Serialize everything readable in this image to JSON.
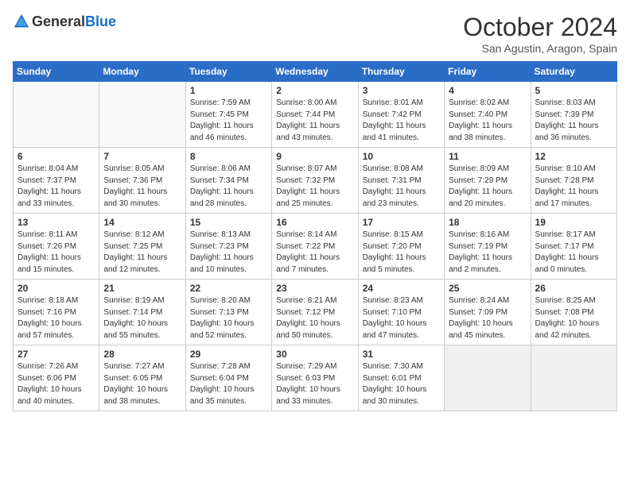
{
  "header": {
    "logo_general": "General",
    "logo_blue": "Blue",
    "month": "October 2024",
    "location": "San Agustin, Aragon, Spain"
  },
  "weekdays": [
    "Sunday",
    "Monday",
    "Tuesday",
    "Wednesday",
    "Thursday",
    "Friday",
    "Saturday"
  ],
  "weeks": [
    [
      {
        "day": "",
        "info": ""
      },
      {
        "day": "",
        "info": ""
      },
      {
        "day": "1",
        "info": "Sunrise: 7:59 AM\nSunset: 7:45 PM\nDaylight: 11 hours and 46 minutes."
      },
      {
        "day": "2",
        "info": "Sunrise: 8:00 AM\nSunset: 7:44 PM\nDaylight: 11 hours and 43 minutes."
      },
      {
        "day": "3",
        "info": "Sunrise: 8:01 AM\nSunset: 7:42 PM\nDaylight: 11 hours and 41 minutes."
      },
      {
        "day": "4",
        "info": "Sunrise: 8:02 AM\nSunset: 7:40 PM\nDaylight: 11 hours and 38 minutes."
      },
      {
        "day": "5",
        "info": "Sunrise: 8:03 AM\nSunset: 7:39 PM\nDaylight: 11 hours and 36 minutes."
      }
    ],
    [
      {
        "day": "6",
        "info": "Sunrise: 8:04 AM\nSunset: 7:37 PM\nDaylight: 11 hours and 33 minutes."
      },
      {
        "day": "7",
        "info": "Sunrise: 8:05 AM\nSunset: 7:36 PM\nDaylight: 11 hours and 30 minutes."
      },
      {
        "day": "8",
        "info": "Sunrise: 8:06 AM\nSunset: 7:34 PM\nDaylight: 11 hours and 28 minutes."
      },
      {
        "day": "9",
        "info": "Sunrise: 8:07 AM\nSunset: 7:32 PM\nDaylight: 11 hours and 25 minutes."
      },
      {
        "day": "10",
        "info": "Sunrise: 8:08 AM\nSunset: 7:31 PM\nDaylight: 11 hours and 23 minutes."
      },
      {
        "day": "11",
        "info": "Sunrise: 8:09 AM\nSunset: 7:29 PM\nDaylight: 11 hours and 20 minutes."
      },
      {
        "day": "12",
        "info": "Sunrise: 8:10 AM\nSunset: 7:28 PM\nDaylight: 11 hours and 17 minutes."
      }
    ],
    [
      {
        "day": "13",
        "info": "Sunrise: 8:11 AM\nSunset: 7:26 PM\nDaylight: 11 hours and 15 minutes."
      },
      {
        "day": "14",
        "info": "Sunrise: 8:12 AM\nSunset: 7:25 PM\nDaylight: 11 hours and 12 minutes."
      },
      {
        "day": "15",
        "info": "Sunrise: 8:13 AM\nSunset: 7:23 PM\nDaylight: 11 hours and 10 minutes."
      },
      {
        "day": "16",
        "info": "Sunrise: 8:14 AM\nSunset: 7:22 PM\nDaylight: 11 hours and 7 minutes."
      },
      {
        "day": "17",
        "info": "Sunrise: 8:15 AM\nSunset: 7:20 PM\nDaylight: 11 hours and 5 minutes."
      },
      {
        "day": "18",
        "info": "Sunrise: 8:16 AM\nSunset: 7:19 PM\nDaylight: 11 hours and 2 minutes."
      },
      {
        "day": "19",
        "info": "Sunrise: 8:17 AM\nSunset: 7:17 PM\nDaylight: 11 hours and 0 minutes."
      }
    ],
    [
      {
        "day": "20",
        "info": "Sunrise: 8:18 AM\nSunset: 7:16 PM\nDaylight: 10 hours and 57 minutes."
      },
      {
        "day": "21",
        "info": "Sunrise: 8:19 AM\nSunset: 7:14 PM\nDaylight: 10 hours and 55 minutes."
      },
      {
        "day": "22",
        "info": "Sunrise: 8:20 AM\nSunset: 7:13 PM\nDaylight: 10 hours and 52 minutes."
      },
      {
        "day": "23",
        "info": "Sunrise: 8:21 AM\nSunset: 7:12 PM\nDaylight: 10 hours and 50 minutes."
      },
      {
        "day": "24",
        "info": "Sunrise: 8:23 AM\nSunset: 7:10 PM\nDaylight: 10 hours and 47 minutes."
      },
      {
        "day": "25",
        "info": "Sunrise: 8:24 AM\nSunset: 7:09 PM\nDaylight: 10 hours and 45 minutes."
      },
      {
        "day": "26",
        "info": "Sunrise: 8:25 AM\nSunset: 7:08 PM\nDaylight: 10 hours and 42 minutes."
      }
    ],
    [
      {
        "day": "27",
        "info": "Sunrise: 7:26 AM\nSunset: 6:06 PM\nDaylight: 10 hours and 40 minutes."
      },
      {
        "day": "28",
        "info": "Sunrise: 7:27 AM\nSunset: 6:05 PM\nDaylight: 10 hours and 38 minutes."
      },
      {
        "day": "29",
        "info": "Sunrise: 7:28 AM\nSunset: 6:04 PM\nDaylight: 10 hours and 35 minutes."
      },
      {
        "day": "30",
        "info": "Sunrise: 7:29 AM\nSunset: 6:03 PM\nDaylight: 10 hours and 33 minutes."
      },
      {
        "day": "31",
        "info": "Sunrise: 7:30 AM\nSunset: 6:01 PM\nDaylight: 10 hours and 30 minutes."
      },
      {
        "day": "",
        "info": ""
      },
      {
        "day": "",
        "info": ""
      }
    ]
  ]
}
